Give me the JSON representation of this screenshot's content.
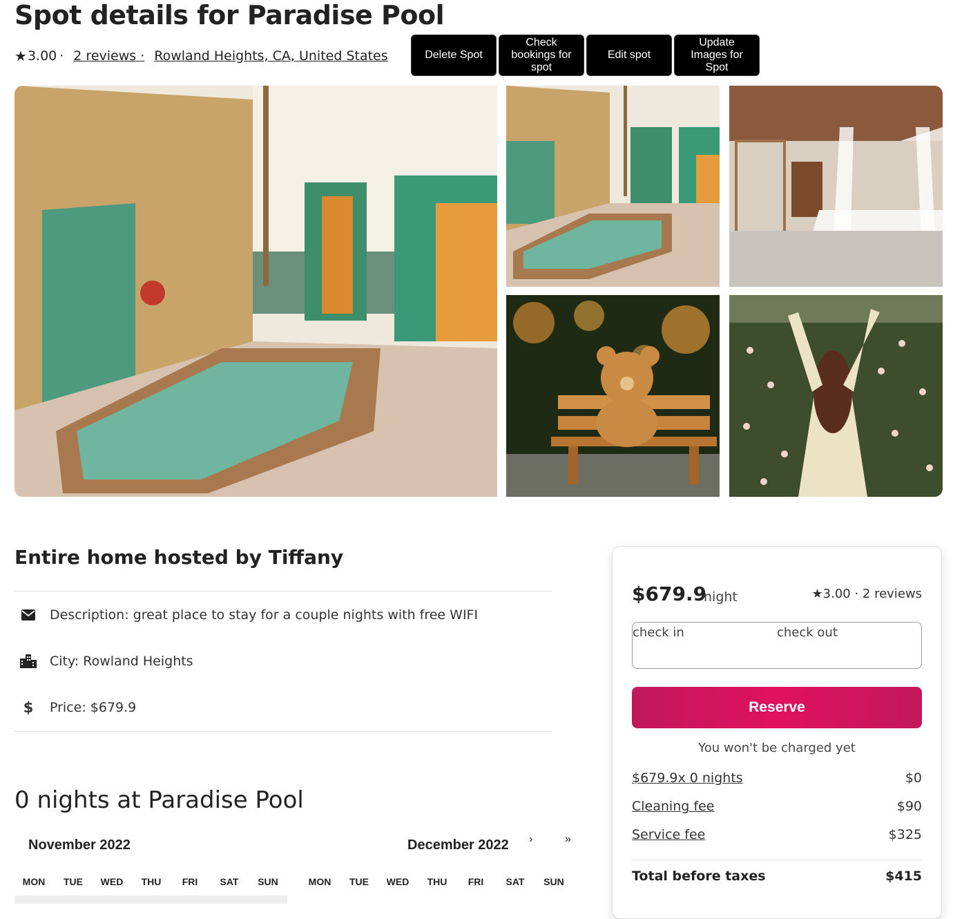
{
  "header": {
    "title": "Spot details for Paradise Pool",
    "rating": "3.00",
    "reviews_link": "2 reviews",
    "location_link": "Rowland Heights, CA, United States",
    "buttons": {
      "delete": "Delete Spot",
      "bookings": "Check bookings for spot",
      "edit": "Edit spot",
      "images": "Update Images for Spot"
    }
  },
  "gallery": {
    "images": [
      "courtyard-pool-main",
      "courtyard-pool",
      "canopy-bedroom",
      "teddy-bear-bench",
      "woman-flower-hedge"
    ]
  },
  "details": {
    "host_heading": "Entire home hosted by Tiffany",
    "description": "Description: great place to stay for a couple nights with free WIFI",
    "city": "City: Rowland Heights",
    "price": "Price: $679.9",
    "icons": [
      "envelope-icon",
      "city-icon",
      "dollar-icon"
    ]
  },
  "calendar": {
    "heading": "0 nights at Paradise Pool",
    "months": [
      "November 2022",
      "December 2022"
    ],
    "nav_next": "›",
    "nav_next2": "»",
    "weekdays": [
      "MON",
      "TUE",
      "WED",
      "THU",
      "FRI",
      "SAT",
      "SUN"
    ]
  },
  "booking": {
    "price": "$679.9",
    "per": "night",
    "rating": "3.00",
    "reviews": "2 reviews",
    "check_in": "check in",
    "check_out": "check out",
    "reserve": "Reserve",
    "note": "You won't be charged yet",
    "fees": [
      {
        "label": "$679.9x 0 nights",
        "value": "$0"
      },
      {
        "label": "Cleaning fee",
        "value": "$90"
      },
      {
        "label": "Service fee",
        "value": "$325"
      }
    ],
    "total_label": "Total before taxes",
    "total_value": "$415",
    "accent": "#e0115f"
  }
}
